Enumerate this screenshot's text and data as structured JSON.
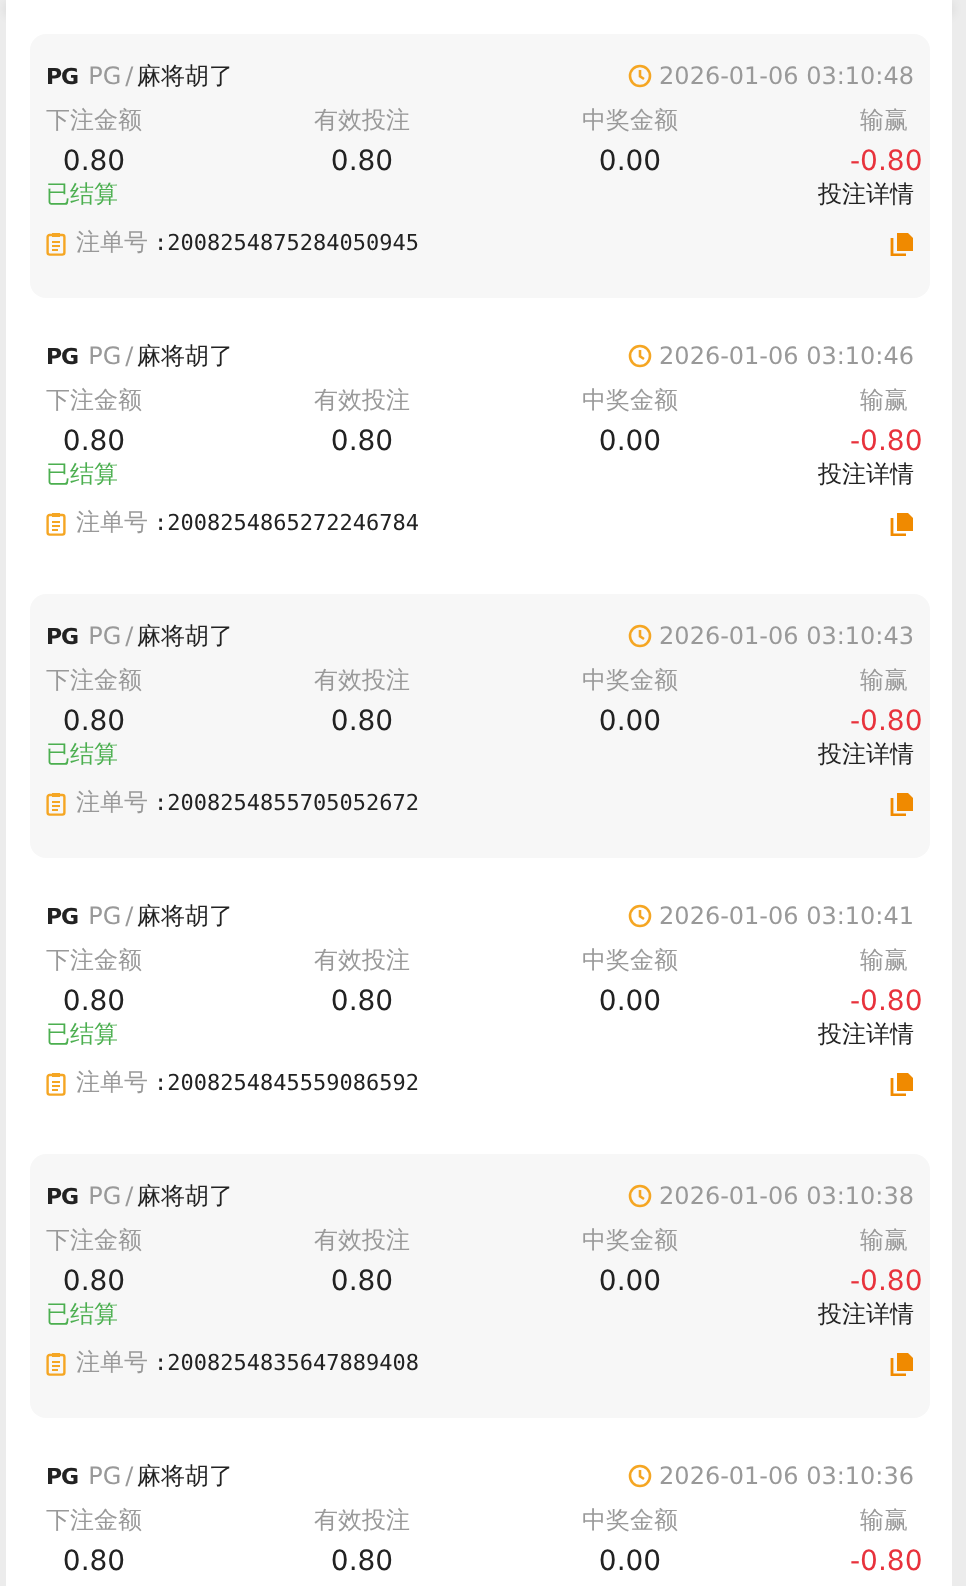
{
  "records": [
    {
      "logo": "PG",
      "provider": "PG",
      "separator": "/",
      "game": "麻将胡了",
      "time": "2026-01-06 03:10:48",
      "labels": [
        "下注金额",
        "有效投注",
        "中奖金额",
        "输赢"
      ],
      "bet": "0.80",
      "valid": "0.80",
      "win": "0.00",
      "profit": "-0.80",
      "status": "已结算",
      "details": "投注详情",
      "order_label": "注单号",
      "order_no": ":2008254875284050945"
    },
    {
      "logo": "PG",
      "provider": "PG",
      "separator": "/",
      "game": "麻将胡了",
      "time": "2026-01-06 03:10:46",
      "labels": [
        "下注金额",
        "有效投注",
        "中奖金额",
        "输赢"
      ],
      "bet": "0.80",
      "valid": "0.80",
      "win": "0.00",
      "profit": "-0.80",
      "status": "已结算",
      "details": "投注详情",
      "order_label": "注单号",
      "order_no": ":2008254865272246784"
    },
    {
      "logo": "PG",
      "provider": "PG",
      "separator": "/",
      "game": "麻将胡了",
      "time": "2026-01-06 03:10:43",
      "labels": [
        "下注金额",
        "有效投注",
        "中奖金额",
        "输赢"
      ],
      "bet": "0.80",
      "valid": "0.80",
      "win": "0.00",
      "profit": "-0.80",
      "status": "已结算",
      "details": "投注详情",
      "order_label": "注单号",
      "order_no": ":2008254855705052672"
    },
    {
      "logo": "PG",
      "provider": "PG",
      "separator": "/",
      "game": "麻将胡了",
      "time": "2026-01-06 03:10:41",
      "labels": [
        "下注金额",
        "有效投注",
        "中奖金额",
        "输赢"
      ],
      "bet": "0.80",
      "valid": "0.80",
      "win": "0.00",
      "profit": "-0.80",
      "status": "已结算",
      "details": "投注详情",
      "order_label": "注单号",
      "order_no": ":2008254845559086592"
    },
    {
      "logo": "PG",
      "provider": "PG",
      "separator": "/",
      "game": "麻将胡了",
      "time": "2026-01-06 03:10:38",
      "labels": [
        "下注金额",
        "有效投注",
        "中奖金额",
        "输赢"
      ],
      "bet": "0.80",
      "valid": "0.80",
      "win": "0.00",
      "profit": "-0.80",
      "status": "已结算",
      "details": "投注详情",
      "order_label": "注单号",
      "order_no": ":2008254835647889408"
    },
    {
      "logo": "PG",
      "provider": "PG",
      "separator": "/",
      "game": "麻将胡了",
      "time": "2026-01-06 03:10:36",
      "labels": [
        "下注金额",
        "有效投注",
        "中奖金额",
        "输赢"
      ],
      "bet": "0.80",
      "valid": "0.80",
      "win": "0.00",
      "profit": "-0.80"
    }
  ]
}
